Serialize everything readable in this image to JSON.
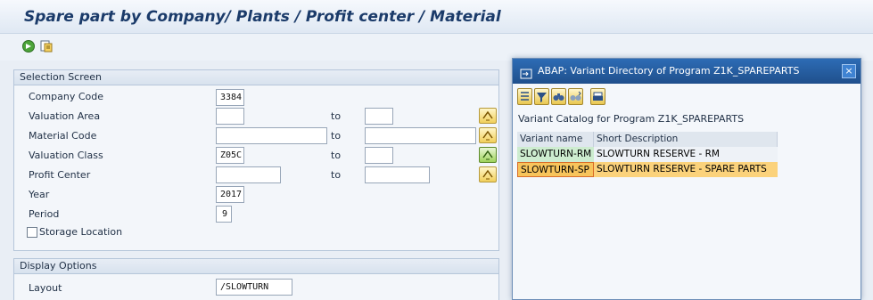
{
  "window": {
    "title": "Spare part by Company/ Plants / Profit center / Material"
  },
  "toolbar": {
    "icons": [
      "execute-icon",
      "get-variant-icon"
    ]
  },
  "selection_screen": {
    "header": "Selection Screen",
    "to_label": "to",
    "fields": [
      {
        "label": "Company Code",
        "value": "3384"
      },
      {
        "label": "Valuation Area",
        "value": "",
        "to_value": ""
      },
      {
        "label": "Material Code",
        "value": "",
        "to_value": ""
      },
      {
        "label": "Valuation Class",
        "value": "Z05C",
        "to_value": ""
      },
      {
        "label": "Profit Center",
        "value": "",
        "to_value": ""
      },
      {
        "label": "Year",
        "value": "2017"
      },
      {
        "label": "Period",
        "value": "9"
      }
    ],
    "checkbox": {
      "label": "Storage Location",
      "checked": false
    }
  },
  "display_options": {
    "header": "Display Options",
    "layout_label": "Layout",
    "layout_value": "/SLOWTURN"
  },
  "popup": {
    "title": "ABAP: Variant Directory of Program Z1K_SPAREPARTS",
    "close_label": "×",
    "catalog_title": "Variant Catalog for Program Z1K_SPAREPARTS",
    "columns": [
      "Variant name",
      "Short Description"
    ],
    "rows": [
      {
        "name": "SLOWTURN-RM",
        "desc": "SLOWTURN RESERVE - RM"
      },
      {
        "name": "SLOWTURN-SP",
        "desc": "SLOWTURN RESERVE - SPARE PARTS"
      }
    ],
    "selected_row": 1,
    "tool_icons": [
      "choose-icon",
      "filter-icon",
      "find-icon",
      "find-next-icon",
      "print-icon"
    ]
  }
}
